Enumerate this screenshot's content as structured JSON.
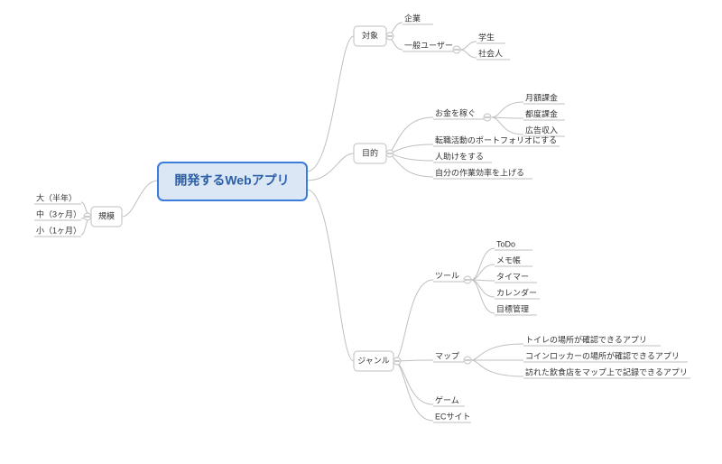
{
  "root": "開発するWebアプリ",
  "branches": {
    "scale": {
      "label": "規模",
      "items": [
        "大（半年）",
        "中（3ヶ月）",
        "小（1ヶ月）"
      ]
    },
    "target": {
      "label": "対象",
      "items": {
        "corp": "企業",
        "general": {
          "label": "一般ユーザー",
          "children": [
            "学生",
            "社会人"
          ]
        }
      }
    },
    "purpose": {
      "label": "目的",
      "items": {
        "money": {
          "label": "お金を稼ぐ",
          "children": [
            "月額課金",
            "都度課金",
            "広告収入"
          ]
        },
        "portfolio": "転職活動のポートフォリオにする",
        "help": "人助けをする",
        "efficiency": "自分の作業効率を上げる"
      }
    },
    "genre": {
      "label": "ジャンル",
      "items": {
        "tool": {
          "label": "ツール",
          "children": [
            "ToDo",
            "メモ帳",
            "タイマー",
            "カレンダー",
            "目標管理"
          ]
        },
        "map": {
          "label": "マップ",
          "children": [
            "トイレの場所が確認できるアプリ",
            "コインロッカーの場所が確認できるアプリ",
            "訪れた飲食店をマップ上で記録できるアプリ"
          ]
        },
        "game": "ゲーム",
        "ec": "ECサイト"
      }
    }
  }
}
